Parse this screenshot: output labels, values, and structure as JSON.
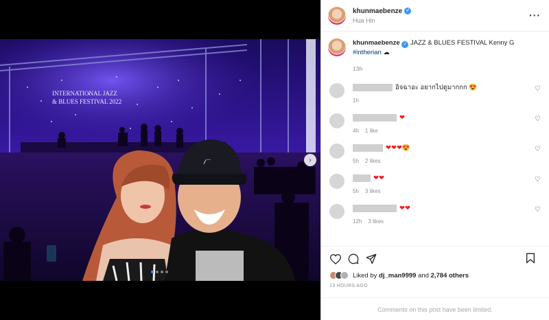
{
  "post": {
    "username": "khunmaebenze",
    "location": "Hua Hin",
    "more_icon": "more-horizontal-icon",
    "verified_icon": "verified-badge-icon"
  },
  "caption": {
    "username": "khunmaebenze",
    "text": "JAZZ & BLUES FESTIVAL Kenny G ",
    "hashtag": "#intherian",
    "emoji": "☁",
    "time": "13h"
  },
  "media": {
    "stage_sign": [
      "INTERNATIONAL JAZZ",
      "& BLUES FESTIVAL 2022"
    ],
    "cap_logo": "⦧",
    "next_icon": "chevron-right-icon",
    "carousel_count": 4,
    "carousel_active": 0
  },
  "comments": [
    {
      "text": "อิจฉาอะ อยากไปดูมากกก 😍",
      "time": "1h",
      "likes": ""
    },
    {
      "text": "❤️",
      "time": "4h",
      "likes": "1 like"
    },
    {
      "text": "❤️❤️❤️😍",
      "time": "5h",
      "likes": "2 likes"
    },
    {
      "text": "❤️❤️",
      "time": "5h",
      "likes": "3 likes"
    },
    {
      "text": "❤️❤️",
      "time": "12h",
      "likes": "3 likes"
    }
  ],
  "actions": {
    "liked_by_prefix": "Liked by ",
    "liked_by_user": "dj_man9999",
    "and": " and ",
    "others": "2,784 others",
    "time_ago": "13 HOURS AGO",
    "limited": "Comments on this post have been limited."
  },
  "colors": {
    "verified": "#3897f0",
    "hashtag": "#00376b",
    "carousel_active": "#3b8eff"
  }
}
